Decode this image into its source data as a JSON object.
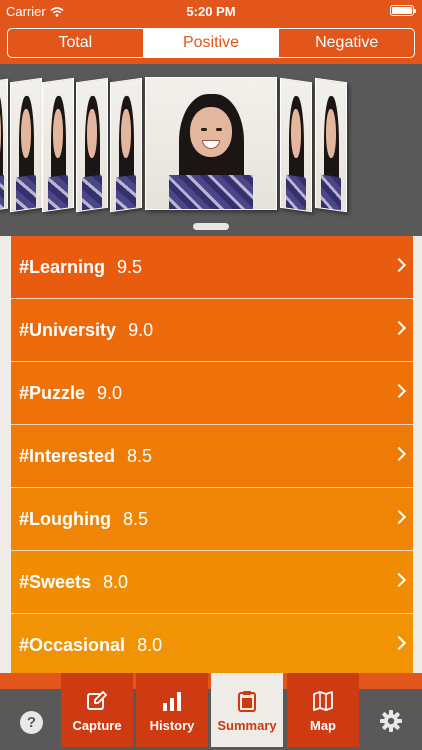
{
  "status_bar": {
    "carrier": "Carrier",
    "time": "5:20 PM"
  },
  "segments": [
    {
      "label": "Total",
      "active": false
    },
    {
      "label": "Positive",
      "active": true
    },
    {
      "label": "Negative",
      "active": false
    }
  ],
  "topics": [
    {
      "tag": "#Learning",
      "score": "9.5",
      "color": "#e95b0f"
    },
    {
      "tag": "#University",
      "score": "9.0",
      "color": "#ed6a0b"
    },
    {
      "tag": "#Puzzle",
      "score": "9.0",
      "color": "#ef7208"
    },
    {
      "tag": "#Interested",
      "score": "8.5",
      "color": "#ef7b07"
    },
    {
      "tag": "#Loughing",
      "score": "8.5",
      "color": "#f08406"
    },
    {
      "tag": "#Sweets",
      "score": "8.0",
      "color": "#f08d05"
    },
    {
      "tag": "#Occasional",
      "score": "8.0",
      "color": "#f09405"
    }
  ],
  "tabs": [
    {
      "label": "Capture",
      "icon": "edit-icon",
      "active": false
    },
    {
      "label": "History",
      "icon": "bar-chart-icon",
      "active": false
    },
    {
      "label": "Summary",
      "icon": "clipboard-icon",
      "active": true
    },
    {
      "label": "Map",
      "icon": "map-icon",
      "active": false
    }
  ],
  "help_label": "?",
  "colors": {
    "brand": "#e2561b",
    "tab_red": "#ce3a12",
    "dark_gray": "#595959",
    "background": "#efebe6"
  }
}
